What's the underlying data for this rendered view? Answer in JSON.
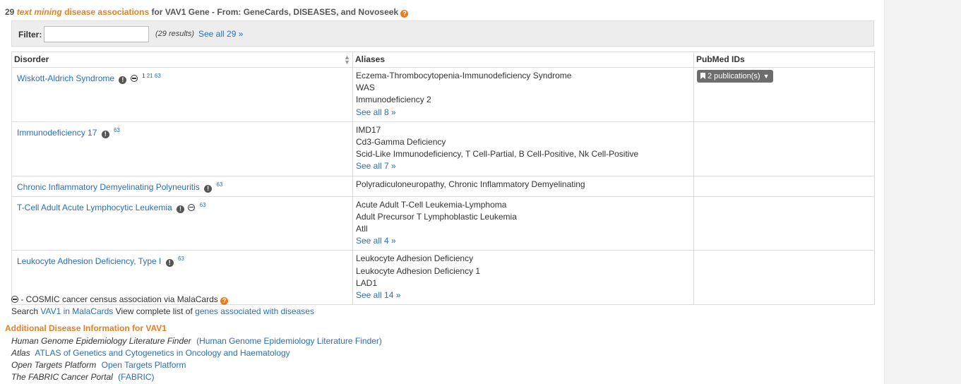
{
  "heading": {
    "count": "29",
    "em": "text mining",
    "mid": "disease associations",
    "rest": "for VAV1 Gene - From: GeneCards, DISEASES, and Novoseek"
  },
  "filter": {
    "label": "Filter:",
    "value": "",
    "placeholder": "",
    "results": "(29 results)",
    "see_all": "See all 29 »"
  },
  "table": {
    "headers": [
      "Disorder",
      "Aliases",
      "PubMed IDs"
    ],
    "rows": [
      {
        "disorder": "Wiskott-Aldrich Syndrome",
        "cosmic": true,
        "refs": [
          "1",
          "21",
          "63"
        ],
        "aliases": [
          "Eczema-Thrombocytopenia-Immunodeficiency Syndrome",
          "WAS",
          "Immunodeficiency 2"
        ],
        "see_all": "See all 8 »",
        "pubmed": "2 publication(s)"
      },
      {
        "disorder": "Immunodeficiency 17",
        "cosmic": false,
        "refs": [
          "63"
        ],
        "aliases": [
          "IMD17",
          "Cd3-Gamma Deficiency",
          "Scid-Like Immunodeficiency, T Cell-Partial, B Cell-Positive, Nk Cell-Positive"
        ],
        "see_all": "See all 7 »",
        "pubmed": ""
      },
      {
        "disorder": "Chronic Inflammatory Demyelinating Polyneuritis",
        "cosmic": false,
        "refs": [
          "63"
        ],
        "aliases": [
          "Polyradiculoneuropathy, Chronic Inflammatory Demyelinating"
        ],
        "see_all": "",
        "pubmed": ""
      },
      {
        "disorder": "T-Cell Adult Acute Lymphocytic Leukemia",
        "cosmic": true,
        "refs": [
          "63"
        ],
        "aliases": [
          "Acute Adult T-Cell Leukemia-Lymphoma",
          "Adult Precursor T Lymphoblastic Leukemia",
          "Atll"
        ],
        "see_all": "See all 4 »",
        "pubmed": ""
      },
      {
        "disorder": "Leukocyte Adhesion Deficiency, Type I",
        "cosmic": false,
        "refs": [
          "63"
        ],
        "aliases": [
          "Leukocyte Adhesion Deficiency",
          "Leukocyte Adhesion Deficiency 1",
          "LAD1"
        ],
        "see_all": "See all 14 »",
        "pubmed": ""
      }
    ]
  },
  "legend": {
    "cosmic_text": "- COSMIC cancer census association via MalaCards",
    "search_prefix": "Search",
    "search_link": "VAV1 in MalaCards",
    "view_text": "View complete list of",
    "view_link": "genes associated with diseases"
  },
  "additional": {
    "title": "Additional Disease Information for VAV1",
    "items": [
      {
        "name": "Human Genome Epidemiology Literature Finder",
        "link": "(Human Genome Epidemiology Literature Finder)"
      },
      {
        "name": "Atlas",
        "link": "ATLAS of Genetics and Cytogenetics in Oncology and Haematology"
      },
      {
        "name": "Open Targets Platform",
        "link": "Open Targets Platform"
      },
      {
        "name": "The FABRIC Cancer Portal",
        "link": "(FABRIC)"
      }
    ]
  },
  "colors": {
    "accent": "#e67e22",
    "link": "#2a6ebb",
    "button": "#6d6d6d",
    "filter_bg": "#ededed"
  },
  "icons": [
    "help-icon",
    "info-icon",
    "cosmic-icon",
    "bookmark-icon",
    "chevron-down-icon",
    "sort-icon"
  ]
}
